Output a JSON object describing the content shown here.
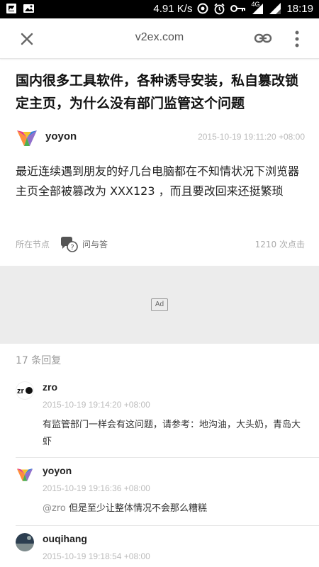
{
  "status_bar": {
    "speed": "4.91 K/s",
    "network": "4G",
    "time": "18:19"
  },
  "toolbar": {
    "url": "v2ex.com"
  },
  "topic": {
    "title": "国内很多工具软件，各种诱导安装，私自篡改锁定主页，为什么没有部门监管这个问题",
    "author": "yoyon",
    "time": "2015-10-19 19:11:20 +08:00",
    "content": "最近连续遇到朋友的好几台电脑都在不知情状况下浏览器主页全部被篡改为 XXX123 ，而且要改回来还挺繁琐",
    "node_label": "所在节点",
    "node_name": "问与答",
    "clicks": "1210 次点击"
  },
  "ad": {
    "badge": "Ad"
  },
  "reply_count": "17 条回复",
  "replies": [
    {
      "author": "zro",
      "time": "2015-10-19 19:14:20 +08:00",
      "text": "有监管部门一样会有这问题，请参考：地沟油，大头奶，青岛大虾"
    },
    {
      "author": "yoyon",
      "time": "2015-10-19 19:16:36 +08:00",
      "mention": "@zro",
      "text": " 但是至少让整体情况不会那么糟糕"
    },
    {
      "author": "ouqihang",
      "time": "2015-10-19 19:18:54 +08:00",
      "text": ""
    }
  ],
  "colors": {
    "status_bar_bg": "#000000",
    "ad_bg": "#ececec",
    "muted_text": "#bbbbbb"
  },
  "icons": [
    "image-icon",
    "photo-icon",
    "data-saver-icon",
    "alarm-icon",
    "vpn-key-icon",
    "signal-icon",
    "battery-icon",
    "close-icon",
    "link-icon",
    "more-vert-icon",
    "chat-question-icon"
  ]
}
